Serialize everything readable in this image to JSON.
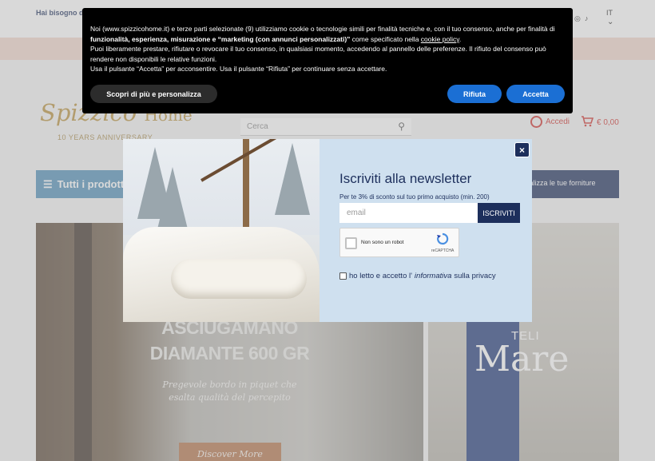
{
  "topbar": {
    "help_text": "Hai bisogno di",
    "language": "IT"
  },
  "header": {
    "brand": "Spizzico Home",
    "brand_tagline": "10 YEARS ANNIVERSARY",
    "search_placeholder": "Cerca",
    "account_label": "Accedi",
    "cart_total": "€ 0,00"
  },
  "nav": {
    "all_products_label": "Tutti i prodotti",
    "right_link": "sonalizza le tue forniture"
  },
  "hero_left": {
    "title_line1": "ASCIUGAMANO",
    "title_line2": "DIAMANTE 600 GR",
    "subtitle_line1": "Pregevole bordo in piquet che",
    "subtitle_line2": "esalta qualità del percepito",
    "cta_label": "Discover More"
  },
  "hero_right": {
    "kicker": "TELI",
    "title": "Mare"
  },
  "cookie_banner": {
    "p1_a": "Noi (www.spizzicohome.it) e terze parti selezionate (9) utilizziamo cookie o tecnologie simili per finalità tecniche e, con il tuo consenso, anche per finalità di ",
    "p1_bold": "funzionalità, esperienza, misurazione e “marketing (con annunci personalizzati)”",
    "p1_b": " come specificato nella ",
    "p1_link": "cookie policy",
    "p1_end": ".",
    "p2": "Puoi liberamente prestare, rifiutare o revocare il tuo consenso, in qualsiasi momento, accedendo al pannello delle preferenze. Il rifiuto del consenso può rendere non disponibili le relative funzioni.",
    "p3": "Usa il pulsante “Accetta” per acconsentire. Usa il pulsante “Rifiuta” per continuare senza accettare.",
    "more_label": "Scopri di più e personalizza",
    "reject_label": "Rifiuta",
    "accept_label": "Accetta"
  },
  "newsletter": {
    "close_label": "×",
    "title": "Iscriviti alla newsletter",
    "subtitle": "Per te 3% di sconto sul tuo primo acquisto (min. 200)",
    "email_placeholder": "email",
    "subscribe_label": "ISCRIVITI",
    "captcha_label": "Non sono un robot",
    "captcha_brand": "reCAPTCHA",
    "privacy_a": "ho letto e accetto l'",
    "privacy_link": "informativa",
    "privacy_b": " sulla privacy"
  },
  "colors": {
    "navy": "#1d2f5c",
    "accent_blue": "#1b6fd4",
    "gold": "#b9913b",
    "red": "#d0312d"
  }
}
